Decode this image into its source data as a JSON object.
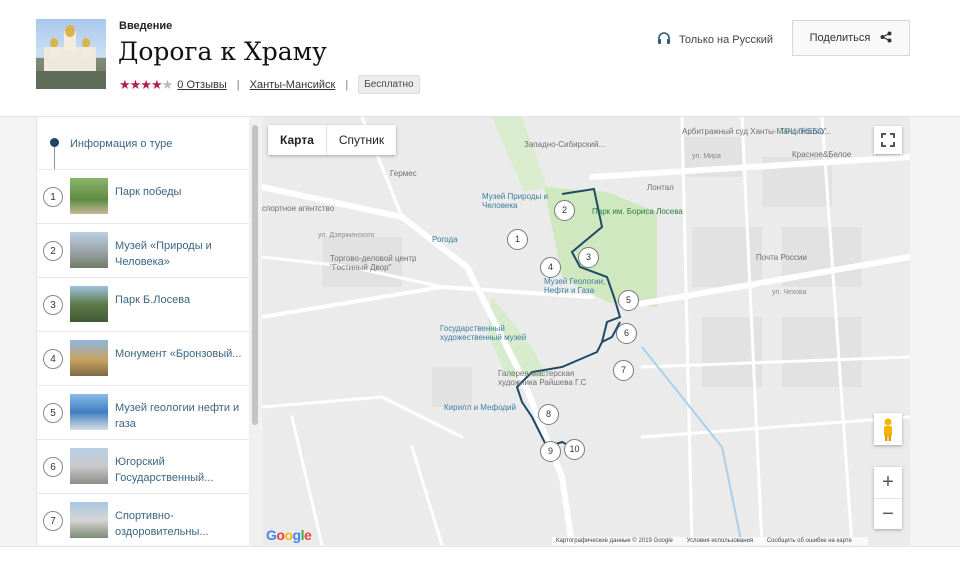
{
  "header": {
    "eyebrow": "Введение",
    "title": "Дорога к Храму",
    "rating_stars": 4,
    "rating_max": 5,
    "reviews_link": "0 Отзывы",
    "location_link": "Ханты-Мансийск",
    "price_badge": "Бесплатно",
    "language": "Только на Русский",
    "share_label": "Поделиться"
  },
  "sidebar": {
    "intro_label": "Информация о туре",
    "stops": [
      {
        "number": "1",
        "name": "Парк победы"
      },
      {
        "number": "2",
        "name": "Музей «Природы и Человека»"
      },
      {
        "number": "3",
        "name": "Парк Б.Лосева"
      },
      {
        "number": "4",
        "name": "Монумент «Бронзовый..."
      },
      {
        "number": "5",
        "name": "Музей геологии нефти и газа"
      },
      {
        "number": "6",
        "name": "Югорский Государственный..."
      },
      {
        "number": "7",
        "name": "Спортивно-оздоровительны..."
      }
    ]
  },
  "map": {
    "tab_map": "Карта",
    "tab_satellite": "Спутник",
    "zoom_in": "+",
    "zoom_out": "−",
    "logo": "Google",
    "footer_data": "Картографические данные © 2019 Google",
    "footer_terms": "Условия использования",
    "footer_report": "Сообщить об ошибке на карте",
    "markers": [
      "1",
      "2",
      "3",
      "4",
      "5",
      "6",
      "7",
      "8",
      "9",
      "10"
    ],
    "labels": {
      "arbitrazh": "Арбитражный суд Ханты-Мансийского...",
      "trc": "ТРЦ \"НЕБО\"",
      "zapsib": "Западно-Сибирский...",
      "krasnoe": "Красное&Белое",
      "germes": "Гермес",
      "lontal": "Лонтал",
      "museum_priroda": "Музей Природы и Человека",
      "park_loseva": "Парк им. Бориса Лосева",
      "sport_agency": "спортное агентство",
      "rogoda": "Рогода",
      "gostiny": "Торгово-деловой центр \"Гостиный Двор\"",
      "pochta": "Почта России",
      "geology": "Музей Геологии, Нефти и Газа",
      "art_museum": "Государственный художественный музей",
      "gallery": "Галерея-мастерская художника Райшева Г.С",
      "kirill": "Кирилл и Мефодий",
      "ul_mira": "ул. Мира",
      "ul_chekhova": "ул. Чехова",
      "ul_dzerzhinskogo": "ул. Дзержинского"
    }
  },
  "colors": {
    "accent": "#b41f4e",
    "link": "#3c6583",
    "route": "#1e4a66",
    "park": "#c8e6b0"
  }
}
